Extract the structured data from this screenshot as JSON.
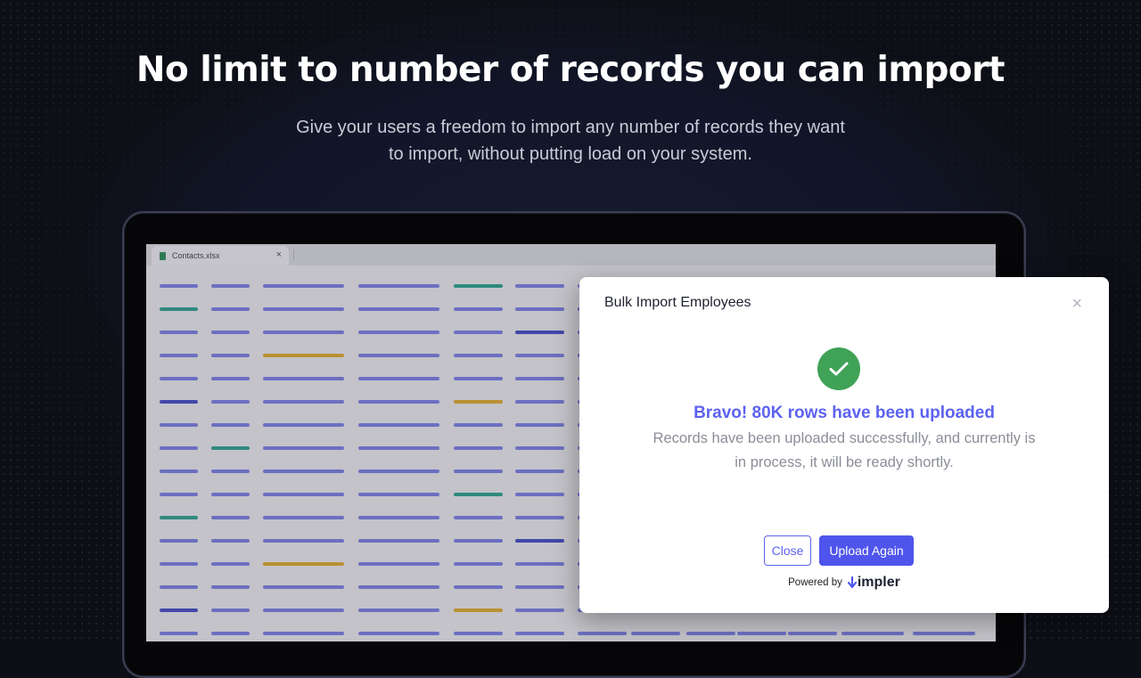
{
  "page": {
    "headline": "No limit to number of records you can import",
    "subtitle_line1": "Give your users a freedom to import any number of records they want",
    "subtitle_line2": "to import, without putting load on your system."
  },
  "spreadsheet": {
    "tab_name": "Contacts.xlsx",
    "tab_close": "×"
  },
  "modal": {
    "title": "Bulk Import Employees",
    "close_glyph": "×",
    "success_icon": "check-circle-icon",
    "heading": "Bravo! 80K rows have been uploaded",
    "body_line1": "Records have been uploaded successfully, and currently is",
    "body_line2": "in process, it will be ready shortly.",
    "close_button": "Close",
    "upload_again_button": "Upload Again",
    "powered_by": "Powered by",
    "brand_name": "impler"
  },
  "colors": {
    "accent": "#5c62f0",
    "success": "#40a257",
    "cell_default": "#7579e8",
    "cell_dark": "#3a40c8",
    "cell_teal": "#1f9e8a",
    "cell_gold": "#e3a81f"
  }
}
